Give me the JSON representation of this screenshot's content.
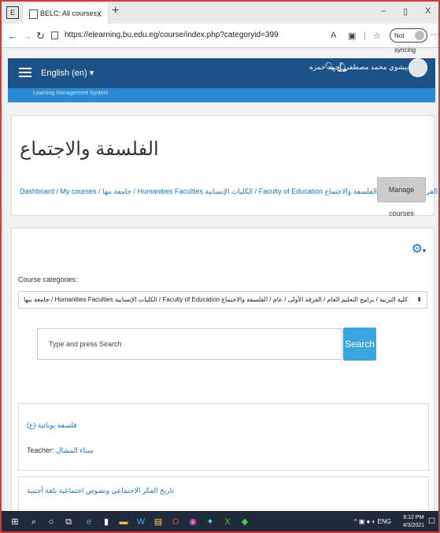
{
  "browser": {
    "tab_title": "BELC: All courses",
    "url": "https://elearning.bu.edu.eg/course/index.php?categoryid=399",
    "sync_label": "Not syncing",
    "new_tab": "+",
    "tab_close": "x",
    "win_min": "–",
    "win_restore": "▯",
    "win_close": "X"
  },
  "navbar": {
    "language": "English (en) ▾",
    "user_name": "بيشوي محمد مصطفى أحمد حمزه",
    "subnav_text": "Learning Management System"
  },
  "header": {
    "title": "الفلسفة والاجتماع",
    "breadcrumb": "Dashboard / My courses / جامعة بنها / Humanities Faculties الكليات الإنسانية / Faculty of Education كلية التربية / برامج التعليم العام / الفرقة الأولى / عام / الفلسفة والاجتماع",
    "manage_button": "Manage courses"
  },
  "main": {
    "categories_label": "Course categories:",
    "category_selected": "جامعة بنها / Humanities Faculties الكليات الإنسانية / Faculty of Education كلية التربية / برامج التعليم العام / الفرقة الأولى / عام / الفلسفة والاجتماع",
    "search_placeholder": "Type and press Search",
    "search_button": "Search",
    "courses": [
      {
        "name": "فلسفة يونانية (ع)",
        "teacher_label": "Teacher:",
        "teacher_name": "سناء المشال"
      },
      {
        "name": "تاريخ الفكر الاجتماعي ونصوص اجتماعية بلغة أجنبية"
      }
    ]
  },
  "taskbar": {
    "time": "6:12 PM",
    "date": "4/3/2021",
    "lang": "ENG"
  }
}
